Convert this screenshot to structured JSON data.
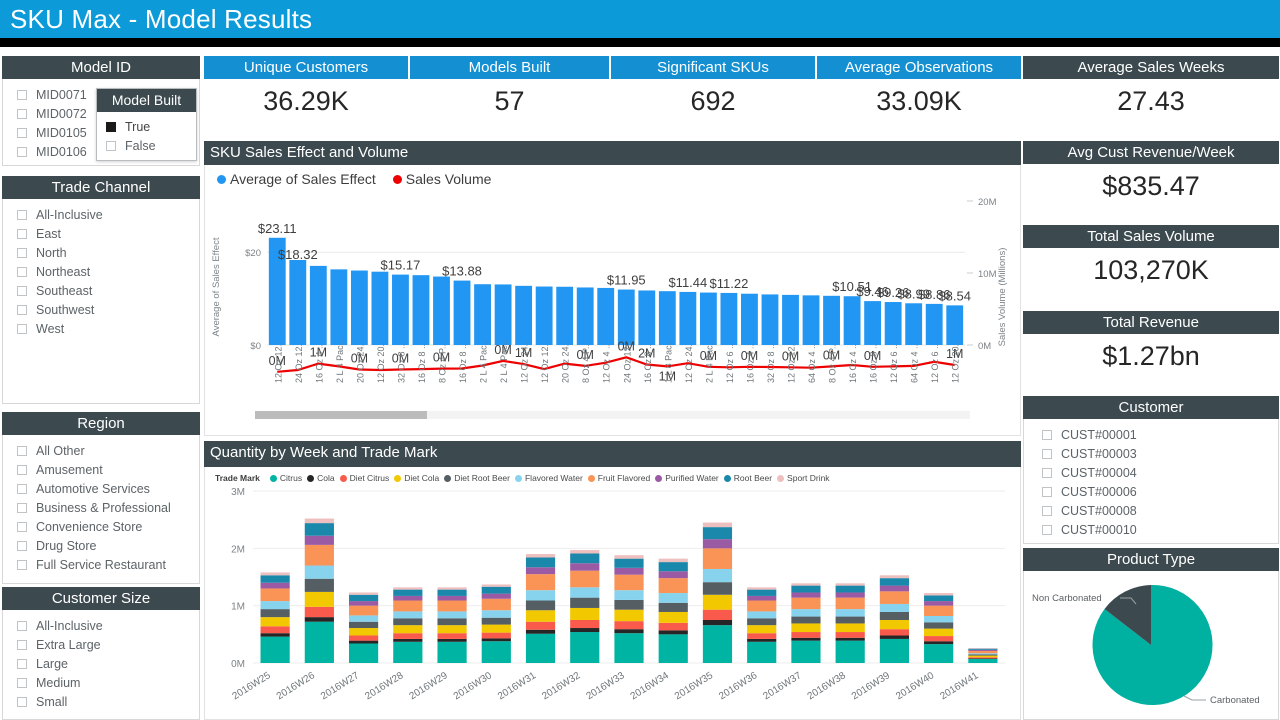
{
  "header": {
    "title": "SKU Max - Model Results",
    "bg": "#0c9bd8"
  },
  "theme": {
    "accent_blue": "#1490d2",
    "panel_dark": "#3c4a4f",
    "bar_blue": "#2196f3",
    "line_red": "#e8112d",
    "teal": "#00b0a0"
  },
  "kpis": [
    {
      "label": "Unique Customers",
      "value": "36.29K",
      "style": "blue"
    },
    {
      "label": "Models Built",
      "value": "57",
      "style": "blue"
    },
    {
      "label": "Significant SKUs",
      "value": "692",
      "style": "blue"
    },
    {
      "label": "Average Observations",
      "value": "33.09K",
      "style": "blue"
    },
    {
      "label": "Average Sales Weeks",
      "value": "27.43",
      "style": "dark"
    },
    {
      "label": "Avg Cust Revenue/Week",
      "value": "$835.47",
      "style": "dark"
    },
    {
      "label": "Total Sales Volume",
      "value": "103,270K",
      "style": "dark"
    },
    {
      "label": "Total Revenue",
      "value": "$1.27bn",
      "style": "dark"
    }
  ],
  "slicers": {
    "model_id": {
      "title": "Model ID",
      "items": [
        "MID0071",
        "MID0072",
        "MID0105",
        "MID0106"
      ]
    },
    "model_built": {
      "title": "Model Built",
      "items": [
        {
          "label": "True",
          "checked": true
        },
        {
          "label": "False",
          "checked": false
        }
      ]
    },
    "trade_channel": {
      "title": "Trade Channel",
      "items": [
        "All-Inclusive",
        "East",
        "North",
        "Northeast",
        "Southeast",
        "Southwest",
        "West"
      ]
    },
    "region": {
      "title": "Region",
      "items": [
        "All Other",
        "Amusement",
        "Automotive Services",
        "Business & Professional",
        "Convenience Store",
        "Drug Store",
        "Full Service Restaurant"
      ]
    },
    "customer_size": {
      "title": "Customer Size",
      "items": [
        "All-Inclusive",
        "Extra Large",
        "Large",
        "Medium",
        "Small"
      ]
    },
    "customer": {
      "title": "Customer",
      "items": [
        "CUST#00001",
        "CUST#00003",
        "CUST#00004",
        "CUST#00006",
        "CUST#00008",
        "CUST#00010"
      ]
    }
  },
  "product_type_panel": {
    "title": "Product Type"
  },
  "sku_chart": {
    "title": "SKU Sales Effect and Volume",
    "legend": [
      {
        "label": "Average of Sales Effect",
        "color": "#2196f3"
      },
      {
        "label": "Sales Volume",
        "color": "#ee0000"
      }
    ]
  },
  "quantity_chart": {
    "title": "Quantity by Week and Trade Mark",
    "legend_title": "Trade Mark"
  },
  "chart_data": [
    {
      "type": "bar",
      "id": "sku-sales-effect-and-volume",
      "title": "SKU Sales Effect and Volume",
      "xlabel": "",
      "ylabel": "Average of Sales Effect",
      "y2label": "Sales Volume (Millions)",
      "ylim": [
        0,
        25
      ],
      "yticks": [
        "$0",
        "$20"
      ],
      "ytickvals": [
        0,
        20
      ],
      "y2lim": [
        0,
        20
      ],
      "y2ticks": [
        "0M",
        "10M",
        "20M"
      ],
      "y2tickvals": [
        0,
        10,
        20
      ],
      "grid": true,
      "legend": [
        "Average of Sales Effect",
        "Sales Volume"
      ],
      "legend_position": "top-left",
      "categories": [
        "12 Oz 12..",
        "24 Oz 12..",
        "16 Oz 4 ..",
        "2 L 4 Pac..",
        "20 Oz 24..",
        "12 Oz 20..",
        "32 Oz 8 ..",
        "16 Oz 8 ..",
        "8 Oz 4 P..",
        "16 Oz 8 ..",
        "2 L 4 Pac..",
        "2 L 4 Pac..",
        "12 Oz 24..",
        "12 Oz 12..",
        "20 Oz 24..",
        "8 Oz 4 P..",
        "12 Oz 4 ..",
        "24 Oz 12..",
        "16 Oz 8 ..",
        "1 L 8 Pac..",
        "12 Oz 24..",
        "2 L 4 Pac..",
        "12 Oz 6 ..",
        "16 Oz 4 ..",
        "32 Oz 8 ..",
        "12 Oz 12..",
        "64 Oz 4 ..",
        "8 Oz 4 P..",
        "16 Oz 4 ..",
        "16 Oz 8 ..",
        "12 Oz 6 ..",
        "64 Oz 4 ..",
        "12 Oz 6 ..",
        "12 Oz 20.."
      ],
      "series": [
        {
          "name": "Average of Sales Effect",
          "color": "#2196f3",
          "axis": "left",
          "values": [
            23.11,
            18.32,
            17.05,
            16.3,
            16.05,
            15.8,
            15.17,
            15.05,
            14.75,
            13.88,
            13.1,
            13.05,
            12.75,
            12.6,
            12.55,
            12.4,
            12.3,
            11.95,
            11.75,
            11.6,
            11.44,
            11.3,
            11.22,
            11.05,
            10.9,
            10.8,
            10.7,
            10.6,
            10.51,
            9.46,
            9.26,
            8.99,
            8.86,
            8.54
          ],
          "labels_shown": [
            "$23.11",
            "$18.32",
            "",
            "",
            "",
            "",
            "$15.17",
            "",
            "",
            "$13.88",
            "",
            "",
            "",
            "",
            "",
            "",
            "",
            "$11.95",
            "",
            "",
            "$11.44",
            "",
            "$11.22",
            "",
            "",
            "",
            "",
            "",
            "$10.51",
            "$9.46",
            "$9.26",
            "$8.99",
            "$8.86",
            "$8.54"
          ]
        },
        {
          "name": "Sales Volume",
          "color": "#ee0000",
          "axis": "right",
          "values": [
            0.35,
            0.55,
            1.25,
            0.95,
            0.6,
            0.55,
            0.6,
            0.65,
            0.7,
            0.72,
            1.05,
            1.55,
            1.2,
            0.65,
            1.25,
            1.0,
            1.35,
            1.95,
            1.15,
            0.95,
            1.3,
            0.9,
            0.85,
            0.9,
            0.88,
            0.85,
            0.8,
            0.95,
            1.1,
            0.9,
            0.95,
            1.0,
            1.45,
            1.1
          ],
          "labels_shown": [
            "0M",
            "",
            "1M",
            "",
            "0M",
            "",
            "0M",
            "",
            "0M",
            "",
            "",
            "0M",
            "1M",
            "",
            "0M",
            "",
            "",
            "0M",
            "2M / 1M",
            "",
            "0M",
            "",
            "",
            "0M",
            "",
            "0M",
            "",
            "0M",
            "",
            "0M",
            "",
            "",
            "",
            "1M"
          ]
        }
      ],
      "scrollbar": {
        "visible": true,
        "thumb_fraction": 0.24
      }
    },
    {
      "type": "bar",
      "id": "quantity-by-week-and-trade-mark",
      "subtype": "stacked",
      "title": "Quantity by Week and Trade Mark",
      "xlabel": "",
      "ylabel": "",
      "ylim": [
        0,
        3
      ],
      "yticks": [
        "0M",
        "1M",
        "2M",
        "3M"
      ],
      "ytickvals": [
        0,
        1,
        2,
        3
      ],
      "grid": true,
      "legend_title": "Trade Mark",
      "legend_position": "top",
      "categories": [
        "2016W25",
        "2016W26",
        "2016W27",
        "2016W28",
        "2016W29",
        "2016W30",
        "2016W31",
        "2016W32",
        "2016W33",
        "2016W34",
        "2016W35",
        "2016W36",
        "2016W37",
        "2016W38",
        "2016W39",
        "2016W40",
        "2016W41"
      ],
      "series": [
        {
          "name": "Citrus",
          "color": "#00b4a4",
          "values": [
            0.46,
            0.72,
            0.34,
            0.37,
            0.37,
            0.38,
            0.51,
            0.54,
            0.52,
            0.5,
            0.66,
            0.37,
            0.39,
            0.39,
            0.42,
            0.33,
            0.07
          ]
        },
        {
          "name": "Cola",
          "color": "#262626",
          "values": [
            0.06,
            0.08,
            0.05,
            0.05,
            0.05,
            0.05,
            0.07,
            0.07,
            0.07,
            0.07,
            0.09,
            0.05,
            0.05,
            0.05,
            0.06,
            0.05,
            0.01
          ]
        },
        {
          "name": "Diet Citrus",
          "color": "#fa5a4b",
          "values": [
            0.12,
            0.18,
            0.09,
            0.1,
            0.1,
            0.1,
            0.14,
            0.14,
            0.14,
            0.13,
            0.18,
            0.1,
            0.1,
            0.1,
            0.11,
            0.09,
            0.02
          ]
        },
        {
          "name": "Diet Cola",
          "color": "#f2c800",
          "values": [
            0.16,
            0.26,
            0.13,
            0.14,
            0.14,
            0.14,
            0.2,
            0.21,
            0.2,
            0.19,
            0.26,
            0.14,
            0.15,
            0.15,
            0.16,
            0.13,
            0.03
          ]
        },
        {
          "name": "Diet Root Beer",
          "color": "#555f63",
          "values": [
            0.14,
            0.23,
            0.11,
            0.12,
            0.12,
            0.12,
            0.17,
            0.18,
            0.17,
            0.16,
            0.22,
            0.12,
            0.12,
            0.12,
            0.14,
            0.11,
            0.02
          ]
        },
        {
          "name": "Flavored Water",
          "color": "#87d3ee",
          "values": [
            0.14,
            0.23,
            0.11,
            0.12,
            0.12,
            0.13,
            0.18,
            0.18,
            0.17,
            0.17,
            0.23,
            0.12,
            0.13,
            0.13,
            0.14,
            0.11,
            0.02
          ]
        },
        {
          "name": "Fruit Flavored",
          "color": "#fa9356",
          "values": [
            0.22,
            0.36,
            0.17,
            0.19,
            0.19,
            0.2,
            0.28,
            0.29,
            0.27,
            0.26,
            0.36,
            0.19,
            0.2,
            0.2,
            0.22,
            0.18,
            0.04
          ]
        },
        {
          "name": "Purified Water",
          "color": "#9b5ba4",
          "values": [
            0.1,
            0.16,
            0.08,
            0.08,
            0.08,
            0.09,
            0.12,
            0.13,
            0.12,
            0.12,
            0.16,
            0.08,
            0.09,
            0.09,
            0.1,
            0.08,
            0.02
          ]
        },
        {
          "name": "Root Beer",
          "color": "#1a88ab",
          "values": [
            0.13,
            0.22,
            0.11,
            0.11,
            0.11,
            0.12,
            0.17,
            0.17,
            0.16,
            0.16,
            0.21,
            0.11,
            0.12,
            0.12,
            0.13,
            0.1,
            0.02
          ]
        },
        {
          "name": "Sport Drink",
          "color": "#eebfbf",
          "values": [
            0.05,
            0.08,
            0.04,
            0.04,
            0.04,
            0.04,
            0.06,
            0.06,
            0.06,
            0.06,
            0.08,
            0.04,
            0.04,
            0.04,
            0.05,
            0.04,
            0.01
          ]
        }
      ]
    },
    {
      "type": "pie",
      "id": "product-type",
      "title": "Product Type",
      "labels": [
        "Carbonated",
        "Non Carbonated"
      ],
      "values": [
        87,
        13
      ],
      "colors": [
        "#00b0a0",
        "#3c4a4f"
      ],
      "annotations": [
        "Non Carbonated",
        "Carbonated"
      ]
    }
  ]
}
